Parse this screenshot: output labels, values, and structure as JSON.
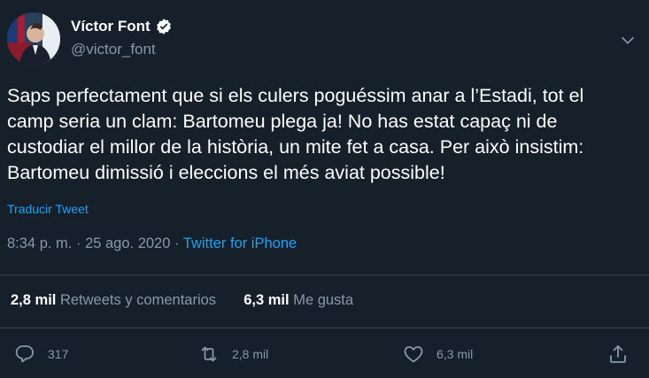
{
  "author": {
    "name": "Víctor Font",
    "handle": "@victor_font"
  },
  "tweet": {
    "text": "Saps perfectament que si els culers poguéssim anar a l’Estadi, tot el\ncamp seria un clam: Bartomeu plega ja! No has estat capaç ni de\ncustodiar el millor de la història, un mite fet a casa. Per això insistim:\nBartomeu dimissió i eleccions el més aviat possible!",
    "translate_label": "Traducir Tweet",
    "time": "8:34 p. m.",
    "separator": "·",
    "date": "25 ago. 2020",
    "source": "Twitter for iPhone"
  },
  "stats": {
    "retweets_count": "2,8 mil",
    "retweets_label": "Retweets y comentarios",
    "likes_count": "6,3 mil",
    "likes_label": "Me gusta"
  },
  "actions": {
    "reply_count": "317",
    "retweet_count": "2,8 mil",
    "like_count": "6,3 mil"
  },
  "colors": {
    "background": "#15202b",
    "accent": "#1da1f2",
    "muted": "#8899a6",
    "divider": "#38444d"
  }
}
